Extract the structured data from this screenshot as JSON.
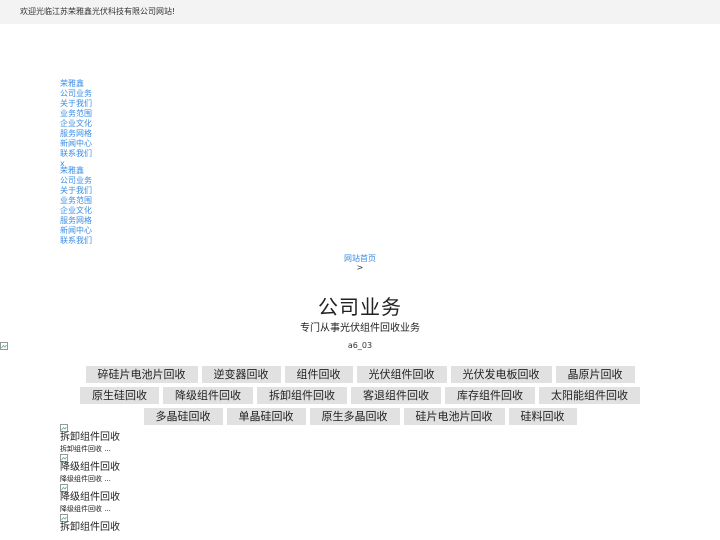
{
  "header": {
    "welcome": "欢迎光临江苏荣雅鑫光伏科技有限公司网站!"
  },
  "nav_primary": [
    "荣雅鑫",
    "公司业务",
    "关于我们",
    "业务范围",
    "企业文化",
    "服务网格",
    "新闻中心",
    "联系我们"
  ],
  "nav_close": "x",
  "nav_secondary": [
    "荣雅鑫",
    "公司业务",
    "关于我们",
    "业务范围",
    "企业文化",
    "服务网格",
    "新闻中心",
    "联系我们"
  ],
  "breadcrumb": {
    "home": "网站首页",
    "separator": ">"
  },
  "section": {
    "title": "公司业务",
    "subtitle": "专门从事光伏组件回收业务",
    "image_alt": "a6_03"
  },
  "tags": [
    "碎硅片电池片回收",
    "逆变器回收",
    "组件回收",
    "光伏组件回收",
    "光伏发电板回收",
    "晶原片回收",
    "原生硅回收",
    "降级组件回收",
    "拆卸组件回收",
    "客退组件回收",
    "库存组件回收",
    "太阳能组件回收",
    "多晶硅回收",
    "单晶硅回收",
    "原生多晶回收",
    "硅片电池片回收",
    "硅料回收"
  ],
  "news": [
    {
      "title": "拆卸组件回收",
      "summary": "拆卸组件回收 ..."
    },
    {
      "title": "降级组件回收",
      "summary": "降级组件回收 ..."
    },
    {
      "title": "降级组件回收",
      "summary": "降级组件回收 ..."
    },
    {
      "title": "拆卸组件回收",
      "summary": ""
    }
  ]
}
